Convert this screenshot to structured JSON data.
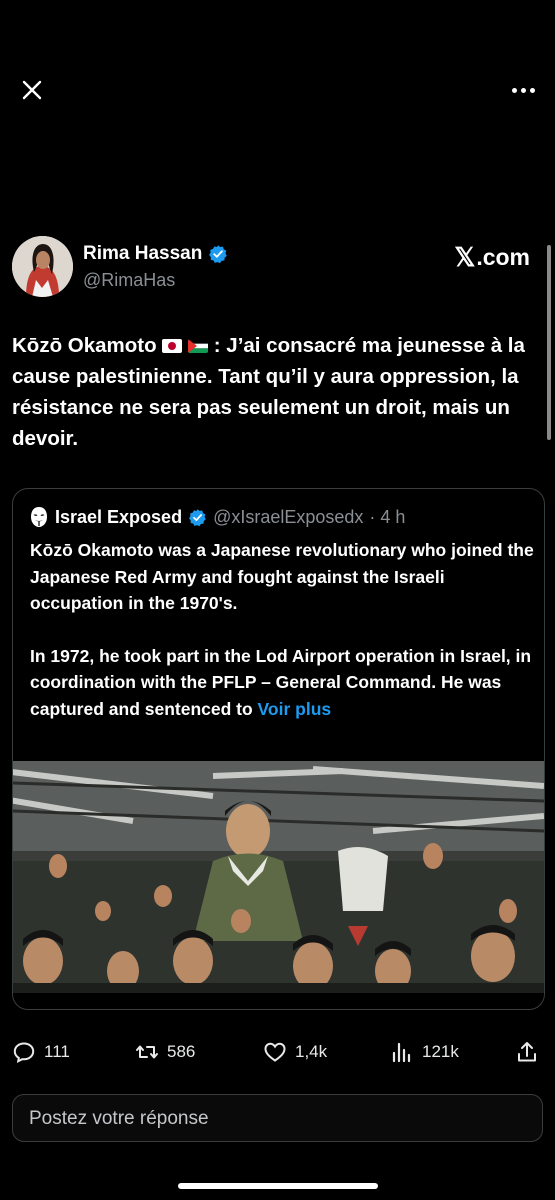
{
  "top_bar": {
    "close_icon": "close-icon",
    "more_icon": "more-icon"
  },
  "author": {
    "name": "Rima Hassan",
    "handle": "@RimaHas",
    "site": ".com",
    "site_mark": "𝕏"
  },
  "tweet": {
    "name_part": "Kōzō Okamoto",
    "after_flags": ": J’ai consacré ma jeunesse",
    "rest": "à la cause palestinienne. Tant qu’il y aura oppression, la résistance ne sera pas seulement un droit, mais un devoir."
  },
  "quote": {
    "name": "Israel Exposed",
    "handle": "@xIsraelExposedx",
    "time": "· 4 h",
    "para1": "Kōzō Okamoto was a Japanese revolutionary who joined the Japanese Red Army and fought against the Israeli occupation in the 1970's.",
    "para2": "In 1972, he took part in the Lod Airport operation in Israel, in coordination with the PFLP – General Command. He was captured and sentenced to ",
    "more": "Voir plus"
  },
  "actions": {
    "replies": "111",
    "retweets": "586",
    "likes": "1,4k",
    "views": "121k"
  },
  "reply_box": {
    "placeholder": "Postez votre réponse"
  },
  "colors": {
    "accent": "#1d9bf0",
    "background": "#000000",
    "secondary_text": "#8b8f94"
  }
}
